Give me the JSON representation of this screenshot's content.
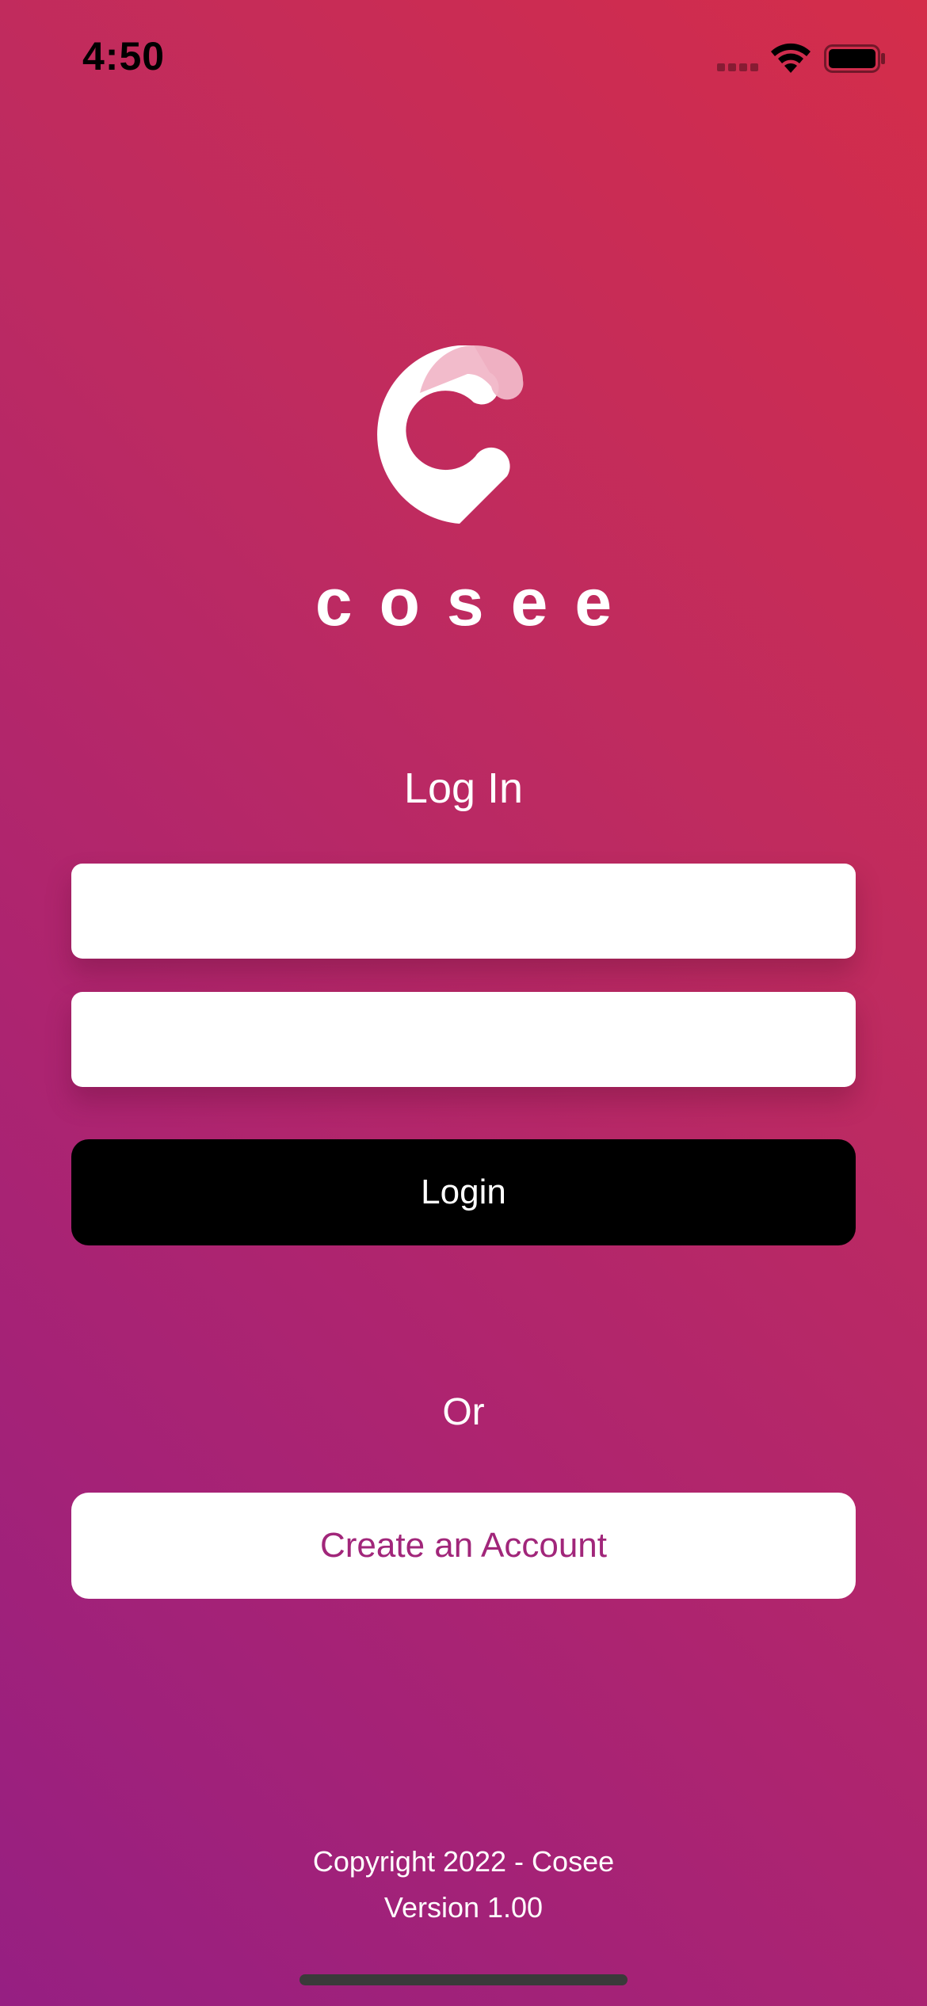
{
  "status_bar": {
    "time": "4:50"
  },
  "icons": {
    "signal": "cellular-signal-icon",
    "wifi": "wifi-icon",
    "battery": "battery-icon",
    "logo": "cosee-pin-logo-icon"
  },
  "brand": {
    "wordmark": "cosee"
  },
  "login_form": {
    "title": "Log In",
    "username_value": "",
    "password_value": "",
    "login_label": "Login",
    "or_label": "Or",
    "create_account_label": "Create an Account"
  },
  "footer": {
    "copyright": "Copyright 2022 - Cosee",
    "version": "Version 1.00"
  },
  "colors": {
    "gradient_top_right": "#d42d4a",
    "gradient_bottom_left": "#961f82",
    "login_button": "#000000",
    "create_account_text": "#a1267a"
  }
}
